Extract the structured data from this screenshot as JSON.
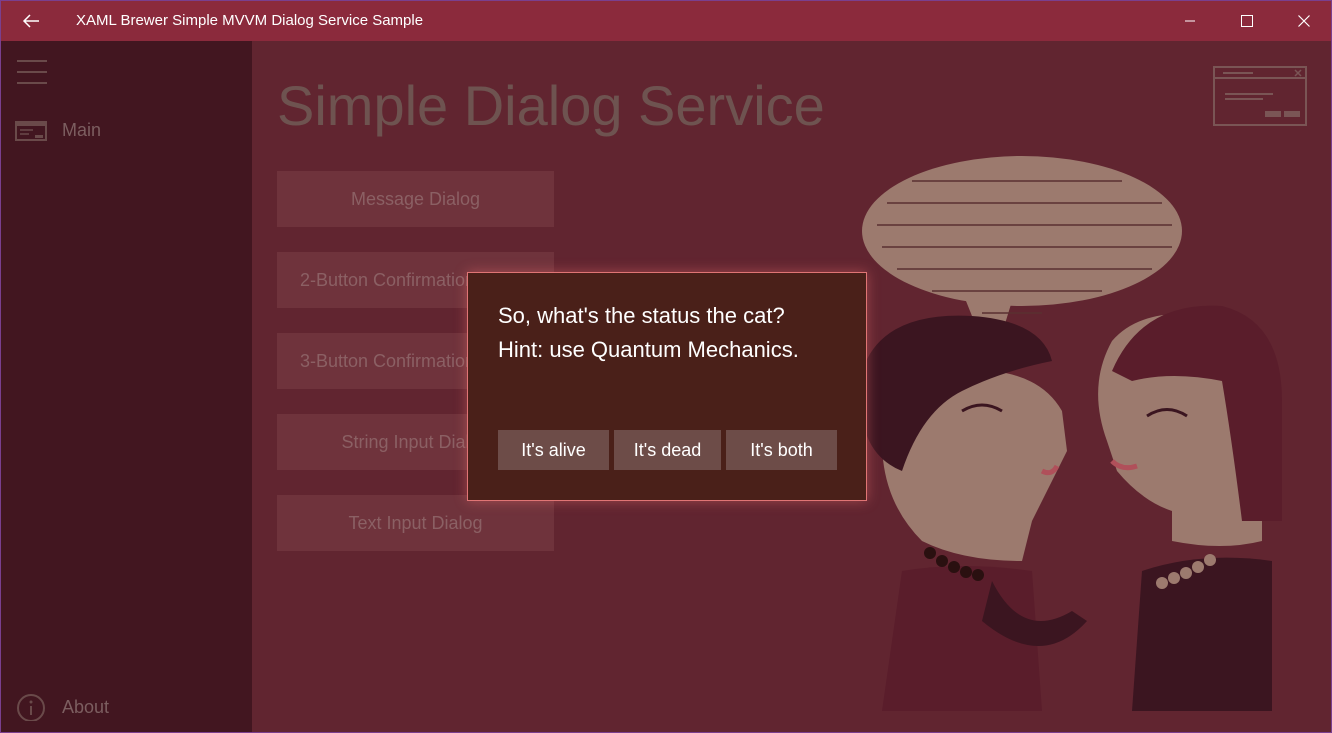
{
  "window": {
    "title": "XAML Brewer Simple MVVM Dialog Service Sample",
    "accent": "#8b2a3c"
  },
  "sidebar": {
    "items": [
      {
        "label": "Main",
        "icon": "window-icon"
      },
      {
        "label": "About",
        "icon": "info-icon"
      }
    ]
  },
  "main": {
    "title": "Simple Dialog Service",
    "buttons": [
      {
        "label": "Message Dialog"
      },
      {
        "label": "2-Button Confirmation Dialog"
      },
      {
        "label": "3-Button Confirmation Dialog"
      },
      {
        "label": "String Input Dialog"
      },
      {
        "label": "Text Input Dialog"
      }
    ],
    "art_text": "GOSSIP speech bubble illustration"
  },
  "dialog": {
    "line1": "So, what's the status the cat?",
    "line2": "Hint: use Quantum Mechanics.",
    "buttons": [
      {
        "label": "It's alive"
      },
      {
        "label": "It's dead"
      },
      {
        "label": "It's both"
      }
    ],
    "border_color": "#e07575"
  }
}
